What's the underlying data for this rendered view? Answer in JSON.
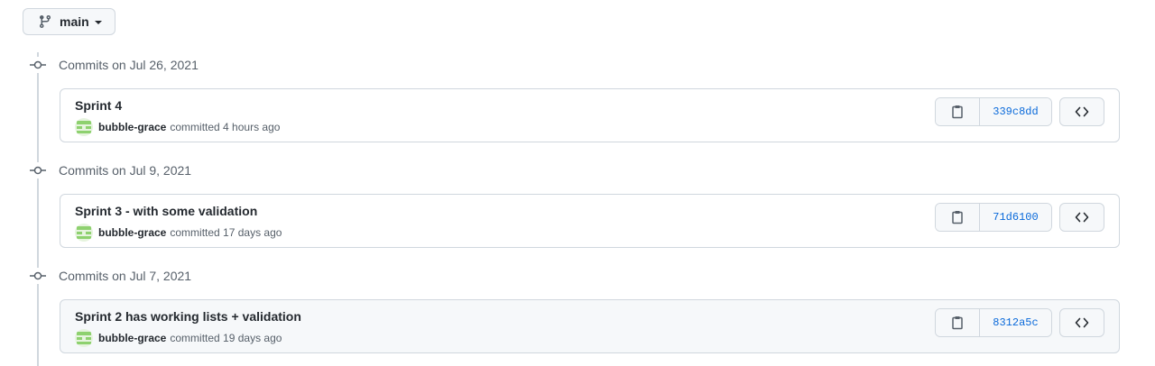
{
  "branch": {
    "name": "main",
    "icon": "git-branch-icon"
  },
  "groups": [
    {
      "title": "Commits on Jul 26, 2021",
      "commit": {
        "message": "Sprint 4",
        "author": "bubble-grace",
        "action": "committed 4 hours ago",
        "sha": "339c8dd"
      }
    },
    {
      "title": "Commits on Jul 9, 2021",
      "commit": {
        "message": "Sprint 3 - with some validation",
        "author": "bubble-grace",
        "action": "committed 17 days ago",
        "sha": "71d6100"
      }
    },
    {
      "title": "Commits on Jul 7, 2021",
      "commit": {
        "message": "Sprint 2 has working lists + validation",
        "author": "bubble-grace",
        "action": "committed 19 days ago",
        "sha": "8312a5c"
      }
    }
  ],
  "colors": {
    "link": "#0969da",
    "border": "#d0d7de",
    "muted": "#57606a",
    "avatar_green": "#8ed16f"
  }
}
